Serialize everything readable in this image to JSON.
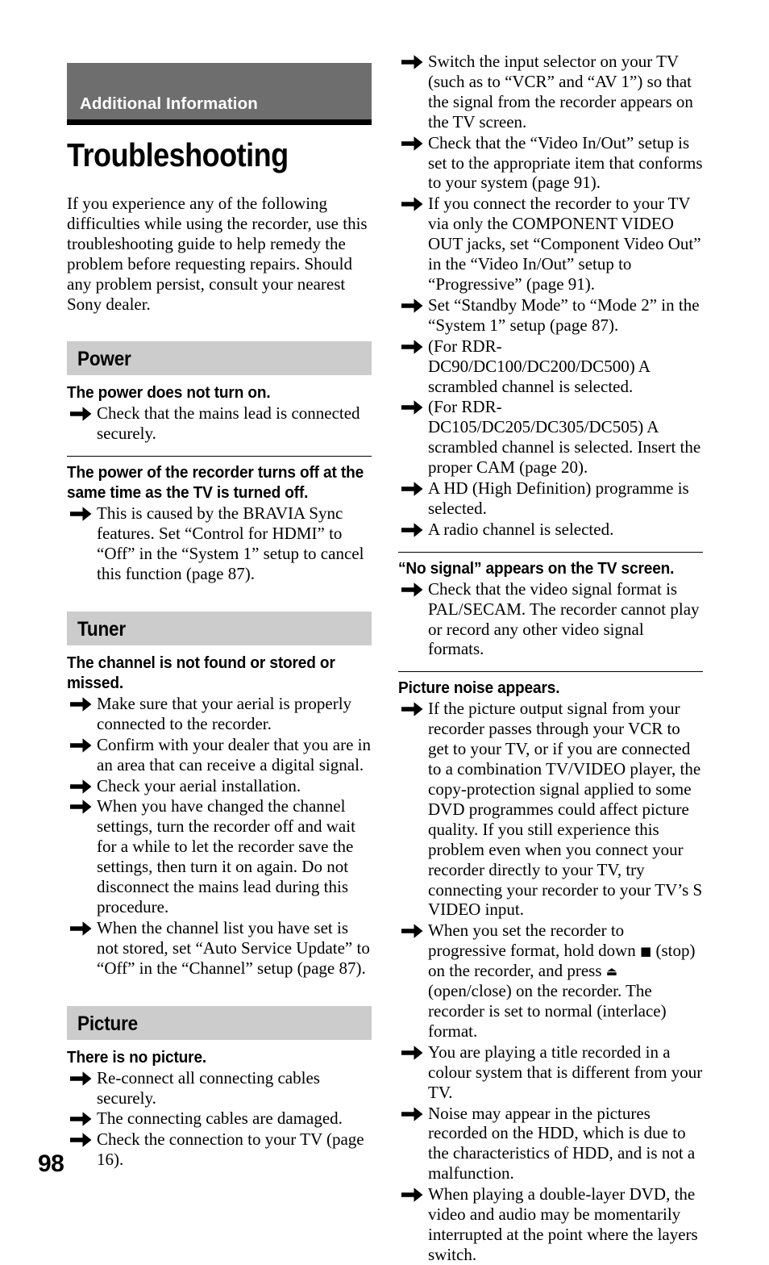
{
  "page": {
    "folio": "98",
    "chapter_banner": "Additional Information",
    "title": "Troubleshooting",
    "intro": "If you experience any of the following difficulties while using the recorder, use this troubleshooting guide to help remedy the problem before requesting repairs. Should any problem persist, consult your nearest Sony dealer.",
    "colors": {
      "banner_gray": "#6e6e6e",
      "section_bar_gray": "#cccccc",
      "text": "#000000",
      "banner_text": "#ffffff"
    }
  },
  "left_column": {
    "sections": [
      {
        "bar_label": "Power",
        "questions": [
          {
            "heading": "The power does not turn on.",
            "ruled": false,
            "answers": [
              "Check that the mains lead is connected securely."
            ]
          },
          {
            "heading": "The power of the recorder turns off at the same time as the TV is turned off.",
            "ruled": true,
            "answers": [
              "This is caused by the BRAVIA Sync features. Set “Control for HDMI” to “Off” in the “System 1” setup to cancel this function (page 87)."
            ]
          }
        ]
      },
      {
        "bar_label": "Tuner",
        "questions": [
          {
            "heading": "The channel is not found or stored or missed.",
            "ruled": false,
            "answers": [
              "Make sure that your aerial is properly connected to the recorder.",
              "Confirm with your dealer that you are in an area that can receive a digital signal.",
              "Check your aerial installation.",
              "When you have changed the channel settings, turn the recorder off and wait for a while to let the recorder save the settings, then turn it on again. Do not disconnect the mains lead during this procedure.",
              "When the channel list you have set is not stored, set “Auto Service Update” to “Off” in the “Channel” setup (page 87)."
            ]
          }
        ]
      },
      {
        "bar_label": "Picture",
        "questions": [
          {
            "heading": "There is no picture.",
            "ruled": false,
            "answers": [
              "Re-connect all connecting cables securely.",
              "The connecting cables are damaged.",
              "Check the connection to your TV (page 16)."
            ]
          }
        ]
      }
    ]
  },
  "right_column": {
    "continued_answers": [
      "Switch the input selector on your TV (such as to “VCR” and “AV 1”) so that the signal from the recorder appears on the TV screen.",
      "Check that the “Video In/Out” setup is set to the appropriate item that conforms to your system (page 91).",
      "If you connect the recorder to your TV via only the COMPONENT VIDEO OUT jacks, set “Component Video Out” in the “Video In/Out” setup to “Progressive” (page 91).",
      "Set “Standby Mode” to “Mode 2” in the “System 1” setup (page 87).",
      "(For RDR-DC90/DC100/DC200/DC500) A scrambled channel is selected.",
      "(For RDR-DC105/DC205/DC305/DC505) A scrambled channel is selected. Insert the proper CAM (page 20).",
      "A HD (High Definition) programme is selected.",
      "A radio channel is selected."
    ],
    "questions": [
      {
        "heading": "“No signal” appears on the TV screen.",
        "ruled": true,
        "answers": [
          "Check that the video signal format is PAL/SECAM. The recorder cannot play or record any other video signal formats."
        ]
      },
      {
        "heading": "Picture noise appears.",
        "ruled": true,
        "answers": [
          "If the picture output signal from your recorder passes through your VCR to get to your TV, or if you are connected to a combination TV/VIDEO player, the copy-protection signal applied to some DVD programmes could affect picture quality. If you still experience this problem even when you connect your recorder directly to your TV, try connecting your recorder to your TV’s S VIDEO input.",
          {
            "parts": [
              "When you set the recorder to progressive format, hold down ",
              {
                "glyph": "stop-icon",
                "char": "■"
              },
              " (stop) on the recorder, and press ",
              {
                "glyph": "open-close-icon",
                "char": "⏏"
              },
              " (open/close) on the recorder. The recorder is set to normal (interlace) format."
            ]
          },
          "You are playing a title recorded in a colour system that is different from your TV.",
          "Noise may appear in the pictures recorded on the HDD, which is due to the characteristics of HDD, and is not a malfunction.",
          "When playing a double-layer DVD, the video and audio may be momentarily interrupted at the point where the layers switch."
        ]
      }
    ]
  }
}
